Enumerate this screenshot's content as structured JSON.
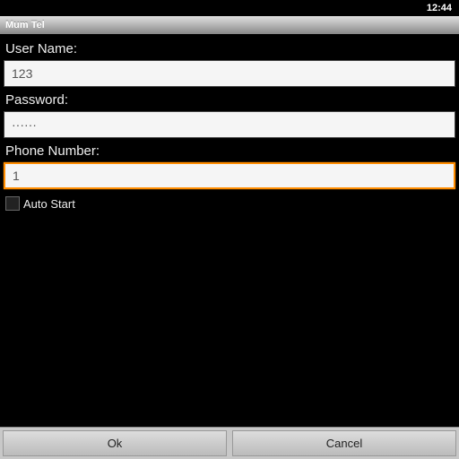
{
  "status": {
    "time": "12:44"
  },
  "title": "Mum Tel",
  "form": {
    "username_label": "User Name:",
    "username_value": "123",
    "password_label": "Password:",
    "password_value": "······",
    "phone_label": "Phone Number:",
    "phone_value": "1",
    "autostart_label": "Auto Start"
  },
  "buttons": {
    "ok": "Ok",
    "cancel": "Cancel"
  }
}
